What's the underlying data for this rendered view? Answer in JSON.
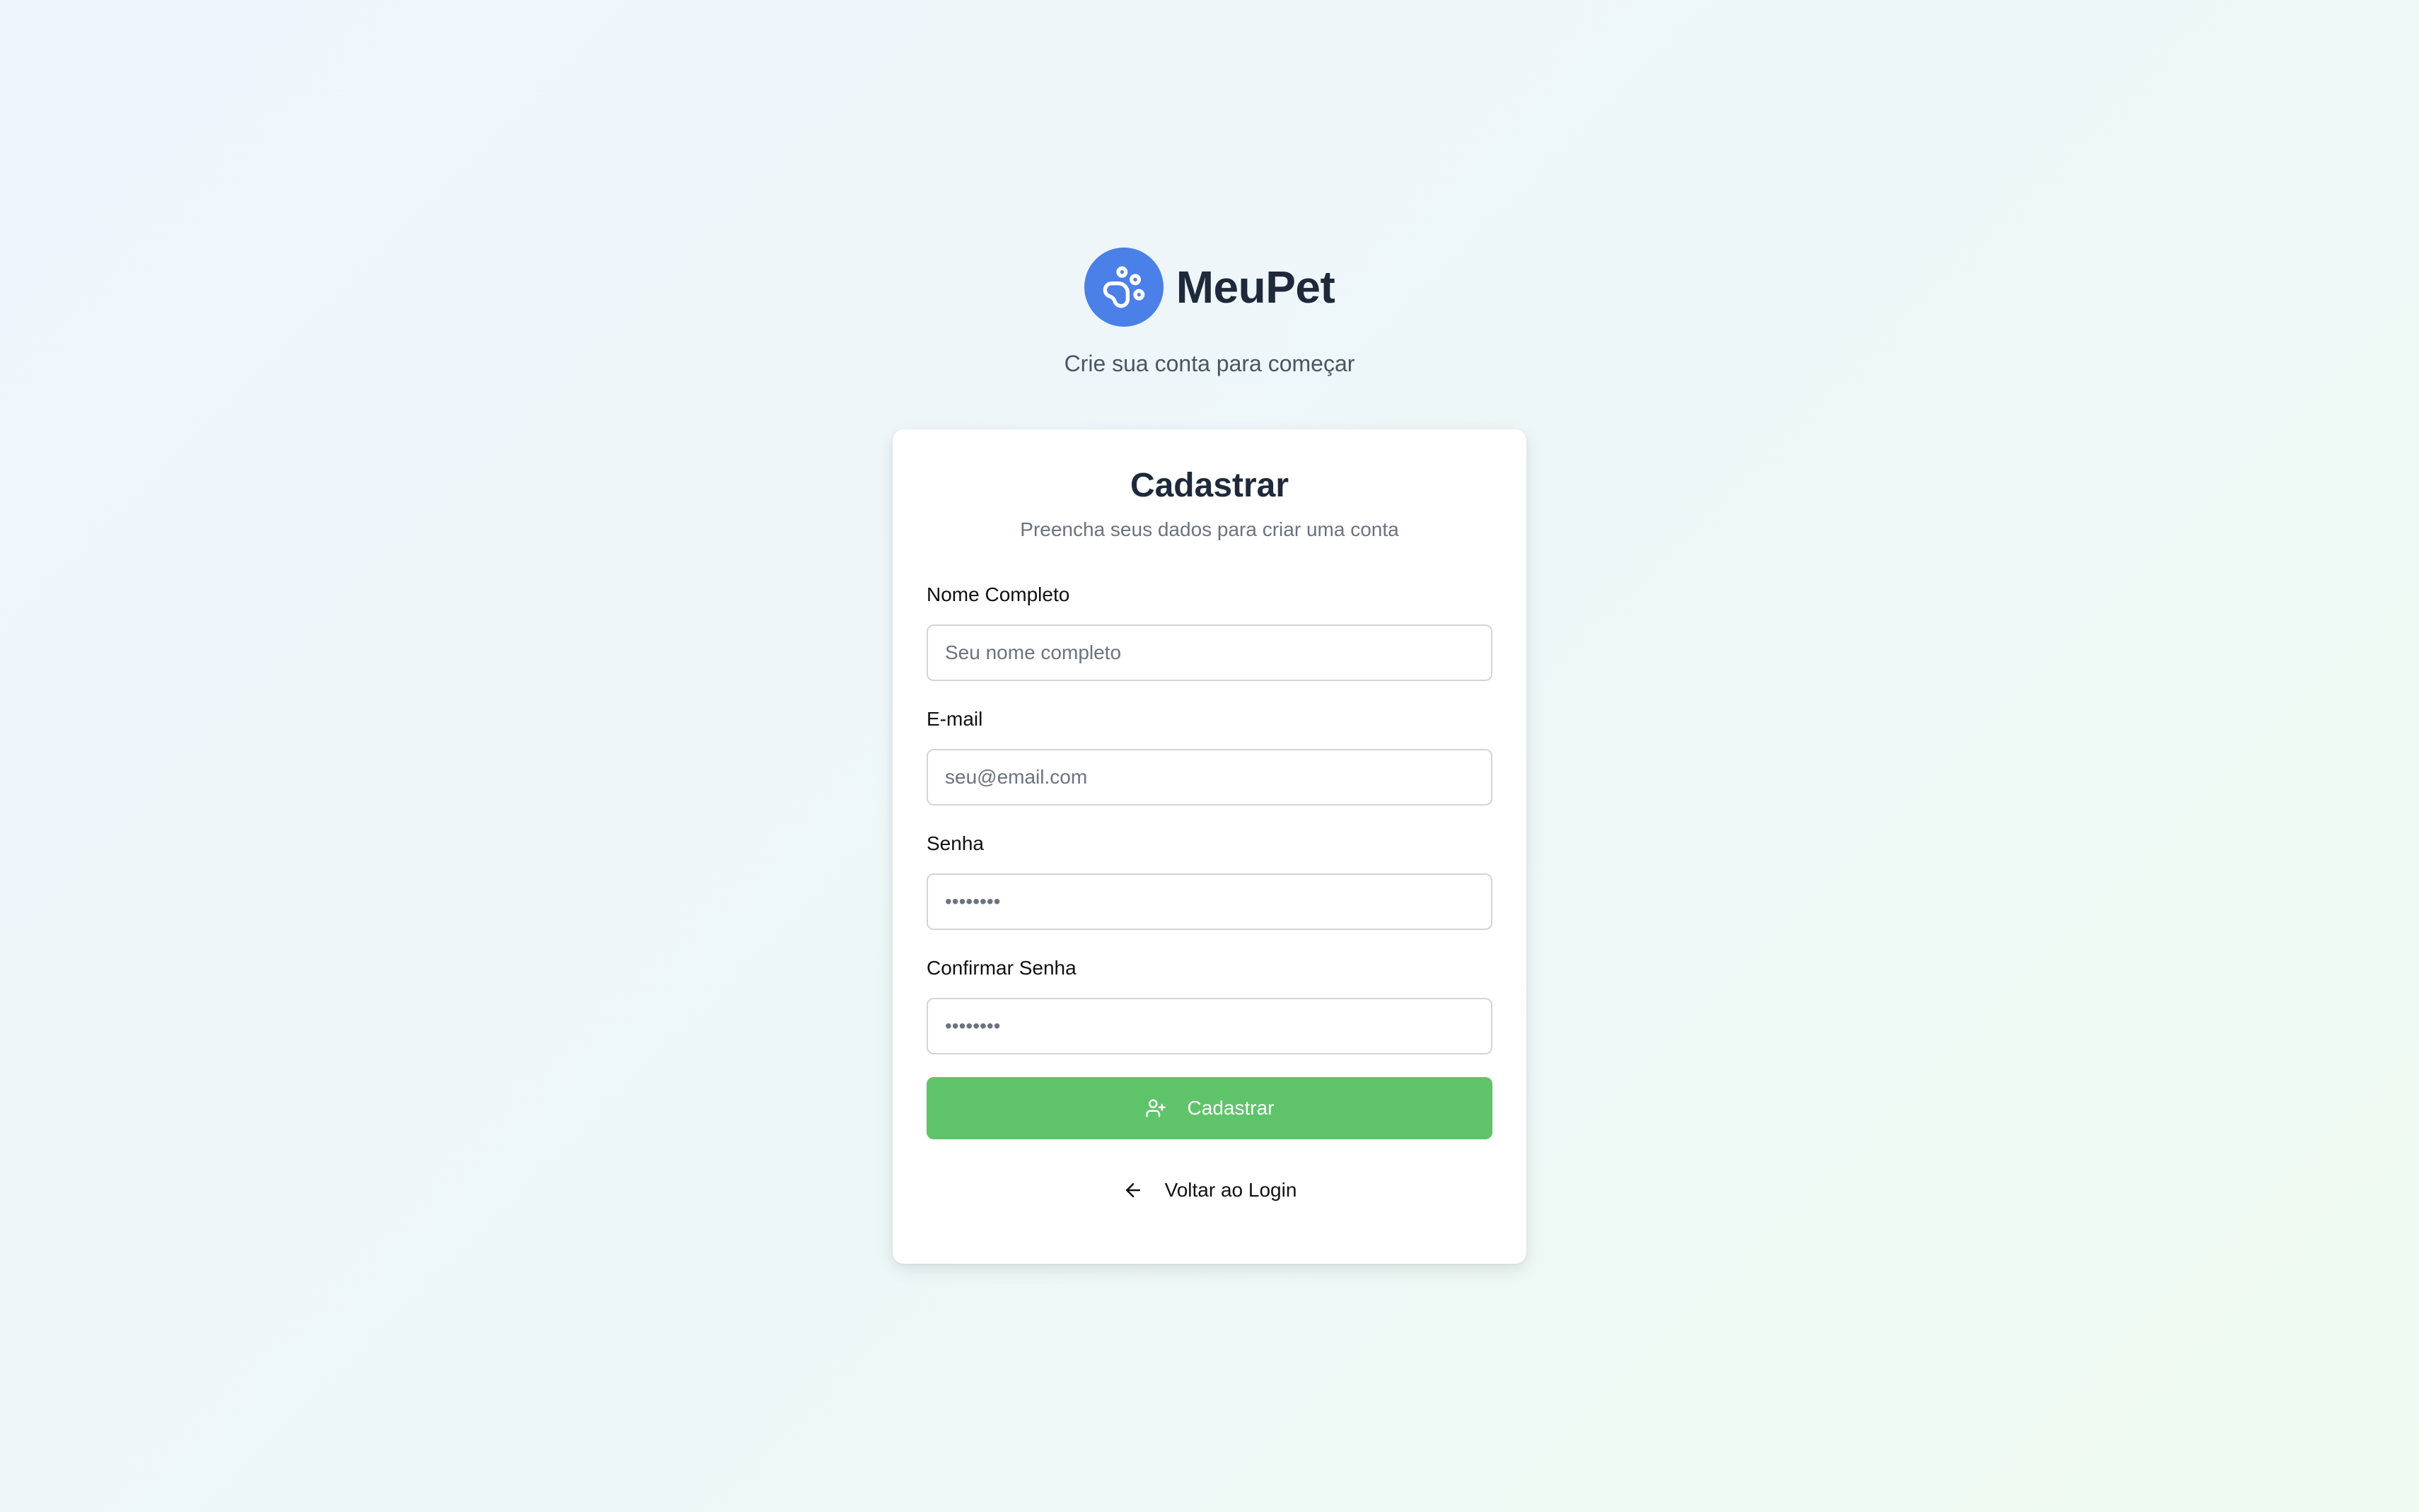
{
  "brand": {
    "name": "MeuPet",
    "logo_icon": "paw-icon",
    "accent_color": "#4a80e8",
    "tagline": "Crie sua conta para começar"
  },
  "form": {
    "title": "Cadastrar",
    "subtitle": "Preencha seus dados para criar uma conta",
    "fields": {
      "name": {
        "label": "Nome Completo",
        "placeholder": "Seu nome completo",
        "value": ""
      },
      "email": {
        "label": "E-mail",
        "placeholder": "seu@email.com",
        "value": ""
      },
      "password": {
        "label": "Senha",
        "placeholder": "••••••••",
        "value": ""
      },
      "confirm_password": {
        "label": "Confirmar Senha",
        "placeholder": "••••••••",
        "value": ""
      }
    },
    "submit": {
      "label": "Cadastrar",
      "icon": "user-plus-icon",
      "color": "#5fc36a"
    },
    "back_link": {
      "label": "Voltar ao Login",
      "icon": "arrow-left-icon"
    }
  }
}
